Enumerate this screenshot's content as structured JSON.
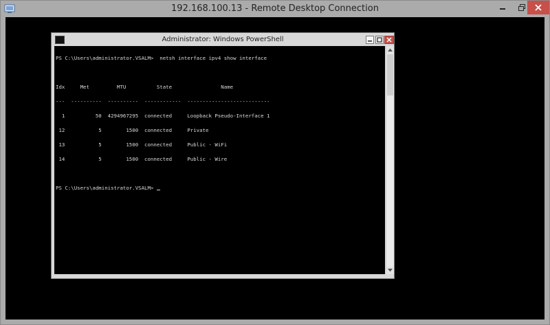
{
  "rdp": {
    "title": "192.168.100.13 - Remote Desktop Connection",
    "app_icon": "remote-desktop-icon"
  },
  "powershell": {
    "title": "Administrator: Windows PowerShell",
    "app_icon": "powershell-icon",
    "console_lines": [
      "PS C:\\Users\\administrator.VSALM>  netsh interface ipv4 show interface",
      "",
      "Idx     Met         MTU          State                Name",
      "---  ----------  ----------  ------------  ---------------------------",
      "  1          50  4294967295  connected     Loopback Pseudo-Interface 1",
      " 12           5        1500  connected     Private",
      " 13           5        1500  connected     Public - WiFi",
      " 14           5        1500  connected     Public - Wire",
      "",
      "PS C:\\Users\\administrator.VSALM> "
    ]
  },
  "colors": {
    "console_bg": "#000000",
    "console_fg": "#d9d9d9",
    "close_button": "#c7504b"
  }
}
